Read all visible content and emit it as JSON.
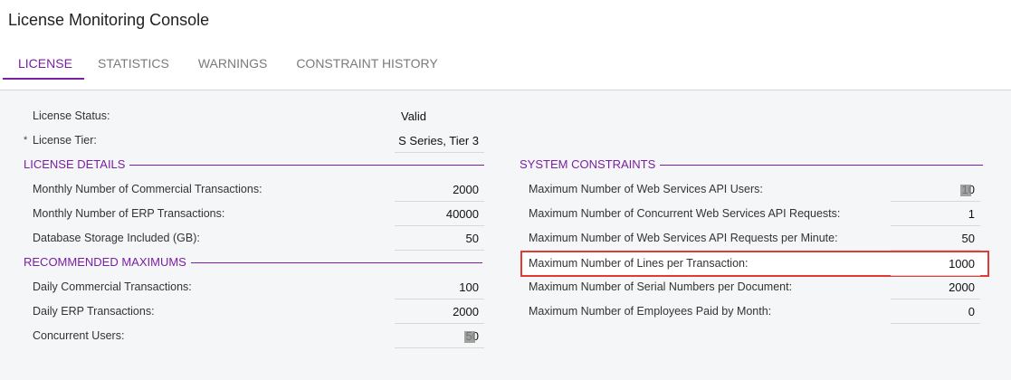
{
  "title": "License Monitoring Console",
  "tabs": [
    {
      "label": "LICENSE"
    },
    {
      "label": "STATISTICS"
    },
    {
      "label": "WARNINGS"
    },
    {
      "label": "CONSTRAINT HISTORY"
    }
  ],
  "license": {
    "status_label": "License Status:",
    "status_value": "Valid",
    "tier_label": "License Tier:",
    "tier_value": "S Series, Tier 3",
    "required_mark": "*"
  },
  "license_details": {
    "heading": "LICENSE DETAILS",
    "items": [
      {
        "label": "Monthly Number of Commercial Transactions:",
        "value": "2000"
      },
      {
        "label": "Monthly Number of ERP Transactions:",
        "value": "40000"
      },
      {
        "label": "Database Storage Included (GB):",
        "value": "50"
      }
    ]
  },
  "recommended_maximums": {
    "heading": "RECOMMENDED MAXIMUMS",
    "items": [
      {
        "label": "Daily Commercial Transactions:",
        "value": "100"
      },
      {
        "label": "Daily ERP Transactions:",
        "value": "2000"
      },
      {
        "label": "Concurrent Users:",
        "value": "50"
      }
    ]
  },
  "system_constraints": {
    "heading": "SYSTEM CONSTRAINTS",
    "items": [
      {
        "label": "Maximum Number of Web Services API Users:",
        "value": "10"
      },
      {
        "label": "Maximum Number of Concurrent Web Services API Requests:",
        "value": "1"
      },
      {
        "label": "Maximum Number of Web Services API Requests per Minute:",
        "value": "50"
      },
      {
        "label": "Maximum Number of Lines per Transaction:",
        "value": "1000"
      },
      {
        "label": "Maximum Number of Serial Numbers per Document:",
        "value": "2000"
      },
      {
        "label": "Maximum Number of Employees Paid by Month:",
        "value": "0"
      }
    ]
  },
  "colors": {
    "accent": "#7b1fa2",
    "highlight_border": "#e53935"
  }
}
